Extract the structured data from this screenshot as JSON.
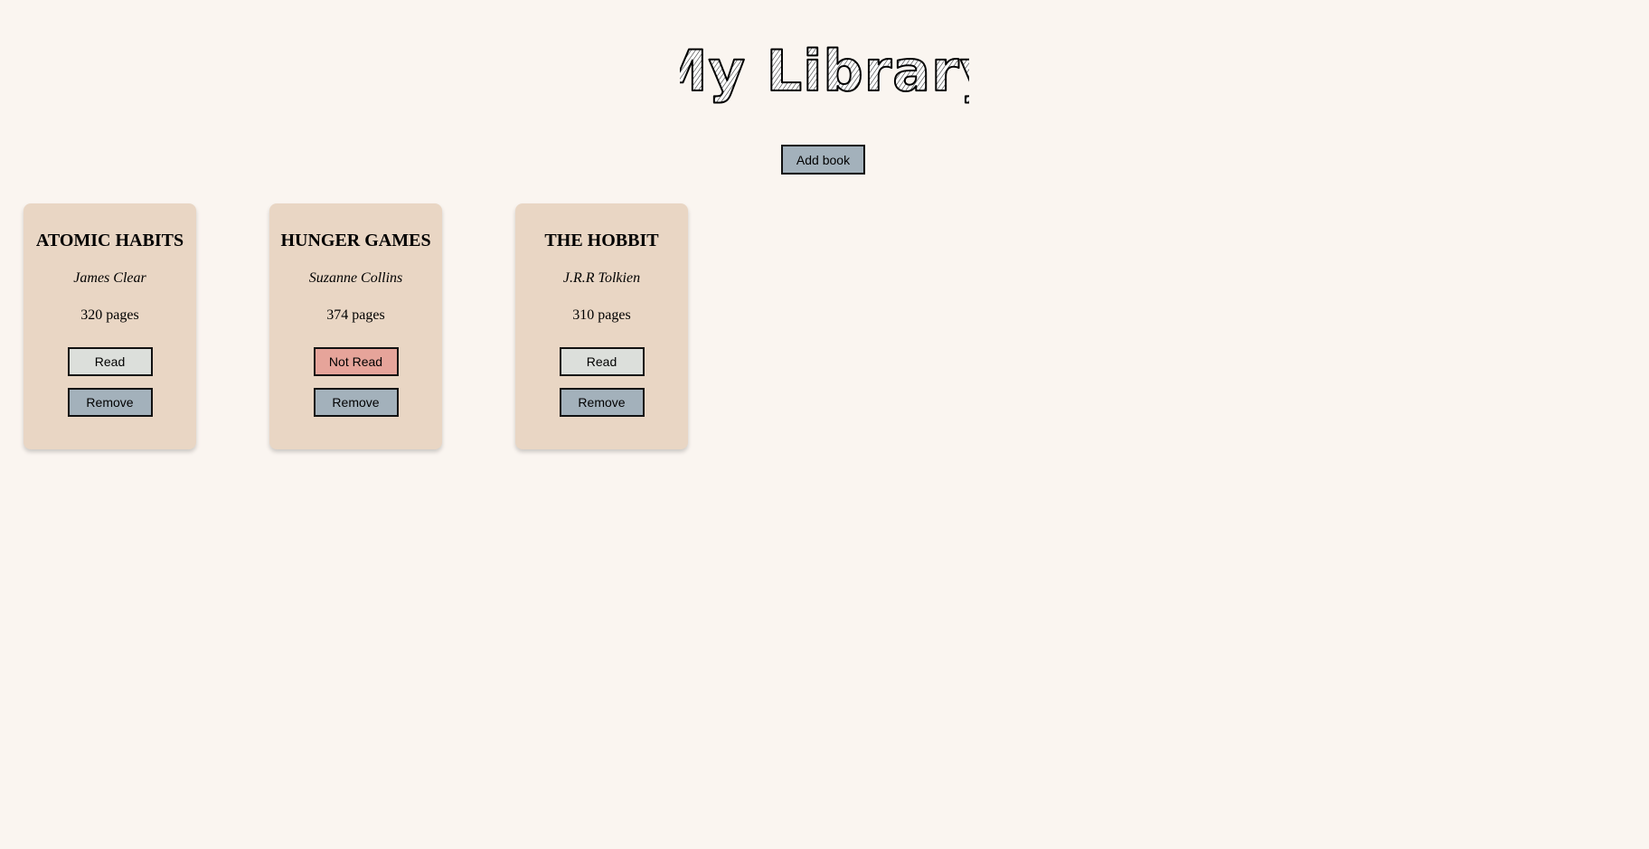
{
  "header": {
    "title": "My Library"
  },
  "toolbar": {
    "add_label": "Add book"
  },
  "colors": {
    "background": "#faf5f0",
    "card": "#e9d6c4",
    "read_button": "#dcdfdb",
    "not_read_button": "#e6a49a",
    "remove_button": "#a3b1bb"
  },
  "books": [
    {
      "title": "ATOMIC HABITS",
      "author": "James Clear",
      "pages": "320 pages",
      "status": "Read",
      "remove": "Remove"
    },
    {
      "title": "HUNGER GAMES",
      "author": "Suzanne Collins",
      "pages": "374 pages",
      "status": "Not Read",
      "remove": "Remove"
    },
    {
      "title": "THE HOBBIT",
      "author": "J.R.R Tolkien",
      "pages": "310 pages",
      "status": "Read",
      "remove": "Remove"
    }
  ]
}
